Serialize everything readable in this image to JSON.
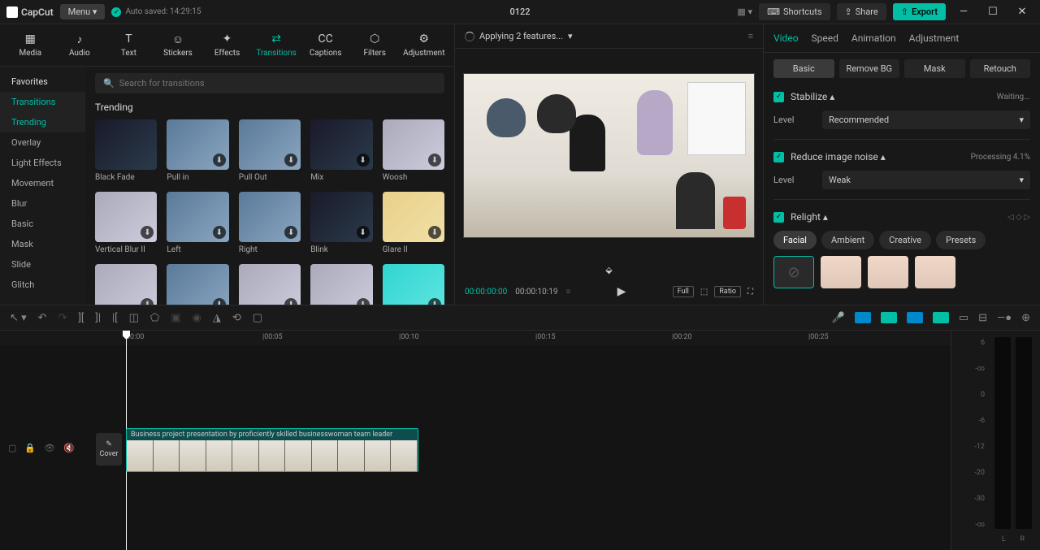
{
  "app_name": "CapCut",
  "menu_label": "Menu",
  "autosave": "Auto saved: 14:29:15",
  "project_title": "0122",
  "toolbar": {
    "shortcuts": "Shortcuts",
    "share": "Share",
    "export": "Export"
  },
  "tabs": [
    "Media",
    "Audio",
    "Text",
    "Stickers",
    "Effects",
    "Transitions",
    "Captions",
    "Filters",
    "Adjustment"
  ],
  "active_tab": "Transitions",
  "sidebar": {
    "favorites": "Favorites",
    "transitions": "Transitions",
    "items": [
      "Trending",
      "Overlay",
      "Light Effects",
      "Movement",
      "Blur",
      "Basic",
      "Mask",
      "Slide",
      "Glitch"
    ]
  },
  "search_placeholder": "Search for transitions",
  "section_title": "Trending",
  "transitions": [
    {
      "label": "Black Fade",
      "cls": "dark"
    },
    {
      "label": "Pull in",
      "cls": ""
    },
    {
      "label": "Pull Out",
      "cls": ""
    },
    {
      "label": "Mix",
      "cls": "dark"
    },
    {
      "label": "Woosh",
      "cls": "blur"
    },
    {
      "label": "Vertical Blur II",
      "cls": "blur"
    },
    {
      "label": "Left",
      "cls": ""
    },
    {
      "label": "Right",
      "cls": ""
    },
    {
      "label": "Blink",
      "cls": "dark"
    },
    {
      "label": "Glare II",
      "cls": "warm"
    },
    {
      "label": "",
      "cls": "blur"
    },
    {
      "label": "",
      "cls": ""
    },
    {
      "label": "",
      "cls": "blur"
    },
    {
      "label": "",
      "cls": "blur"
    },
    {
      "label": "",
      "cls": "cyan"
    }
  ],
  "preview": {
    "status": "Applying 2 features...",
    "time_current": "00:00:00:00",
    "time_duration": "00:00:10:19",
    "full": "Full",
    "ratio": "Ratio"
  },
  "right": {
    "tabs": [
      "Video",
      "Speed",
      "Animation",
      "Adjustment"
    ],
    "subtabs": [
      "Basic",
      "Remove BG",
      "Mask",
      "Retouch"
    ],
    "stabilize": {
      "label": "Stabilize",
      "status": "Waiting...",
      "level_label": "Level",
      "level_value": "Recommended"
    },
    "noise": {
      "label": "Reduce image noise",
      "status": "Processing 4.1%",
      "level_label": "Level",
      "level_value": "Weak"
    },
    "relight": {
      "label": "Relight",
      "pills": [
        "Facial",
        "Ambient",
        "Creative",
        "Presets"
      ]
    }
  },
  "ruler": [
    "00:00",
    "|00:05",
    "|00:10",
    "|00:15",
    "|00:20",
    "|00:25"
  ],
  "cover_label": "Cover",
  "clip_title": "Business project presentation by proficiently skilled businesswoman team leader",
  "meter_scale": [
    "6",
    "-∞",
    "0",
    "-6",
    "-12",
    "-20",
    "-30",
    "-∞"
  ],
  "meter_lr": [
    "L",
    "R"
  ]
}
